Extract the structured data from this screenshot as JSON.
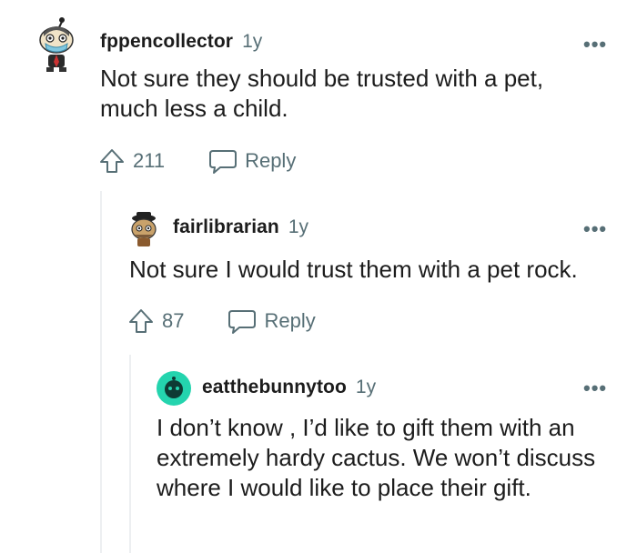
{
  "comments": [
    {
      "username": "fppencollector",
      "age": "1y",
      "text": "Not sure they should be trusted with a pet, much less a child.",
      "votes": "211",
      "reply_label": "Reply",
      "avatar_icon": "snoo-avatar-icon"
    },
    {
      "username": "fairlibrarian",
      "age": "1y",
      "text": "Not sure I would trust them with a pet rock.",
      "votes": "87",
      "reply_label": "Reply",
      "avatar_icon": "snoo-avatar-icon"
    },
    {
      "username": "eatthebunnytoo",
      "age": "1y",
      "text": "I don’t know , I’d like to gift them with an extremely hardy cactus. We won’t discuss where I would like to place their gift.",
      "avatar_icon": "default-avatar-icon"
    }
  ],
  "more_label": "•••",
  "colors": {
    "muted": "#576f76",
    "text": "#1c1c1c",
    "thread_line": "#edeff1",
    "default_avatar": "#24d4ae"
  }
}
